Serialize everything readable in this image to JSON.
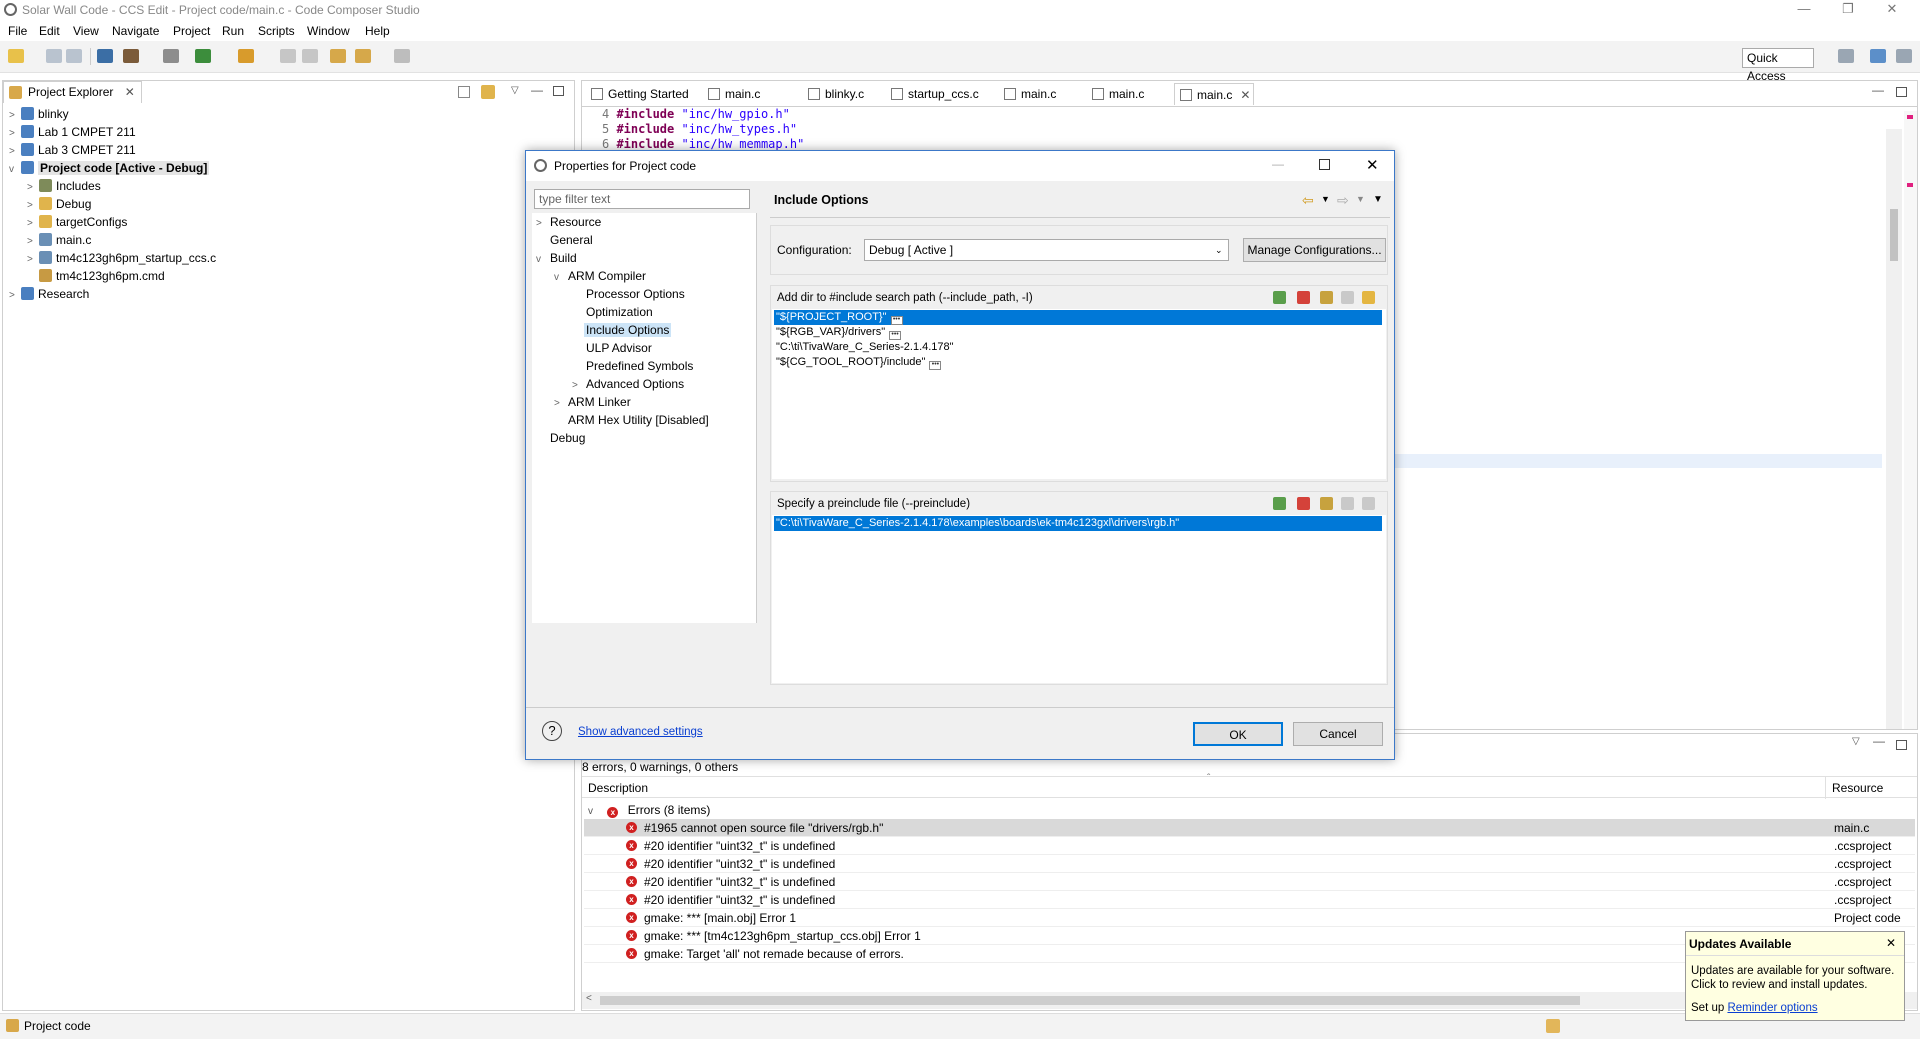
{
  "window": {
    "title": "Solar Wall Code - CCS Edit - Project code/main.c - Code Composer Studio"
  },
  "menu": [
    "File",
    "Edit",
    "View",
    "Navigate",
    "Project",
    "Run",
    "Scripts",
    "Window",
    "Help"
  ],
  "quick_access": "Quick Access",
  "project_explorer": {
    "tab_label": "Project Explorer",
    "items": [
      {
        "label": "blinky",
        "indent": 0,
        "kind": "project"
      },
      {
        "label": "Lab 1 CMPET 211",
        "indent": 0,
        "kind": "project"
      },
      {
        "label": "Lab 3 CMPET 211",
        "indent": 0,
        "kind": "project"
      },
      {
        "label": "Project code  [Active - Debug]",
        "indent": 0,
        "kind": "project-active"
      },
      {
        "label": "Includes",
        "indent": 1,
        "kind": "includes"
      },
      {
        "label": "Debug",
        "indent": 1,
        "kind": "folder"
      },
      {
        "label": "targetConfigs",
        "indent": 1,
        "kind": "folder"
      },
      {
        "label": "main.c",
        "indent": 1,
        "kind": "cfile"
      },
      {
        "label": "tm4c123gh6pm_startup_ccs.c",
        "indent": 1,
        "kind": "cfile"
      },
      {
        "label": "tm4c123gh6pm.cmd",
        "indent": 1,
        "kind": "cmdfile"
      },
      {
        "label": "Research",
        "indent": 0,
        "kind": "project"
      }
    ]
  },
  "editor": {
    "tabs": [
      "Getting Started",
      "main.c",
      "blinky.c",
      "startup_ccs.c",
      "main.c",
      "main.c",
      "main.c"
    ],
    "active_tab_index": 6,
    "lines": [
      {
        "num": "4",
        "kw": "#include",
        "str": "\"inc/hw_gpio.h\""
      },
      {
        "num": "5",
        "kw": "#include",
        "str": "\"inc/hw_types.h\""
      },
      {
        "num": "6",
        "kw": "#include",
        "str": "\"inc/hw_memmap.h\""
      }
    ]
  },
  "problems": {
    "summary": "8 errors, 0 warnings, 0 others",
    "col_description": "Description",
    "col_resource": "Resource",
    "group_label": "Errors (8 items)",
    "rows": [
      {
        "desc": "#1965 cannot open source file \"drivers/rgb.h\"",
        "res": "main.c"
      },
      {
        "desc": "#20 identifier \"uint32_t\" is undefined",
        "res": ".ccsproject"
      },
      {
        "desc": "#20 identifier \"uint32_t\" is undefined",
        "res": ".ccsproject"
      },
      {
        "desc": "#20 identifier \"uint32_t\" is undefined",
        "res": ".ccsproject"
      },
      {
        "desc": "#20 identifier \"uint32_t\" is undefined",
        "res": ".ccsproject"
      },
      {
        "desc": "gmake: *** [main.obj] Error 1",
        "res": "Project code"
      },
      {
        "desc": "gmake: *** [tm4c123gh6pm_startup_ccs.obj] Error 1",
        "res": ""
      },
      {
        "desc": "gmake: Target 'all' not remade because of errors.",
        "res": ""
      }
    ]
  },
  "status_bar": {
    "text": "Project code"
  },
  "updates": {
    "title": "Updates Available",
    "body": "Updates are available for your software. Click to review and install updates.",
    "setup_prefix": "Set up ",
    "setup_link": "Reminder options"
  },
  "dialog": {
    "title": "Properties for Project code",
    "filter_placeholder": "type filter text",
    "nav": [
      {
        "label": "Resource",
        "indent": 0,
        "twisty": ">"
      },
      {
        "label": "General",
        "indent": 0,
        "twisty": ""
      },
      {
        "label": "Build",
        "indent": 0,
        "twisty": "v"
      },
      {
        "label": "ARM Compiler",
        "indent": 1,
        "twisty": "v"
      },
      {
        "label": "Processor Options",
        "indent": 2,
        "twisty": ""
      },
      {
        "label": "Optimization",
        "indent": 2,
        "twisty": ""
      },
      {
        "label": "Include Options",
        "indent": 2,
        "twisty": "",
        "selected": true
      },
      {
        "label": "ULP Advisor",
        "indent": 2,
        "twisty": ""
      },
      {
        "label": "Predefined Symbols",
        "indent": 2,
        "twisty": ""
      },
      {
        "label": "Advanced Options",
        "indent": 2,
        "twisty": ">"
      },
      {
        "label": "ARM Linker",
        "indent": 1,
        "twisty": ">"
      },
      {
        "label": "ARM Hex Utility  [Disabled]",
        "indent": 1,
        "twisty": ""
      },
      {
        "label": "Debug",
        "indent": 0,
        "twisty": ""
      }
    ],
    "page_title": "Include Options",
    "config_label": "Configuration:",
    "config_value": "Debug  [ Active ]",
    "manage_button": "Manage Configurations...",
    "include_label": "Add dir to #include search path (--include_path, -I)",
    "include_paths": [
      {
        "text": "\"${PROJECT_ROOT}\"",
        "dots": true,
        "selected": true
      },
      {
        "text": "\"${RGB_VAR}/drivers\"",
        "dots": true,
        "selected": false
      },
      {
        "text": "\"C:\\ti\\TivaWare_C_Series-2.1.4.178\"",
        "dots": false,
        "selected": false
      },
      {
        "text": "\"${CG_TOOL_ROOT}/include\"",
        "dots": true,
        "selected": false
      }
    ],
    "preinclude_label": "Specify a preinclude file (--preinclude)",
    "preinclude_files": [
      {
        "text": "\"C:\\ti\\TivaWare_C_Series-2.1.4.178\\examples\\boards\\ek-tm4c123gxl\\drivers\\rgb.h\"",
        "selected": true
      }
    ],
    "help_glyph": "?",
    "advanced_link": "Show advanced settings",
    "ok_button": "OK",
    "cancel_button": "Cancel"
  }
}
